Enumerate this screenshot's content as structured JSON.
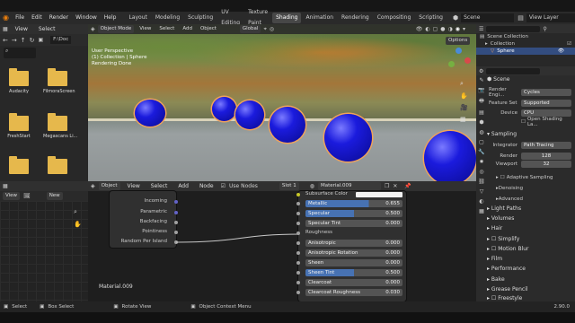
{
  "topbar": {
    "menus": [
      "File",
      "Edit",
      "Render",
      "Window",
      "Help"
    ],
    "workspaces": [
      "Layout",
      "Modeling",
      "Sculpting",
      "UV Editing",
      "Texture Paint",
      "Shading",
      "Animation",
      "Rendering",
      "Compositing",
      "Scripting"
    ],
    "active_workspace": "Shading",
    "scene": "Scene",
    "view_layer": "View Layer"
  },
  "filebrowser": {
    "menus": [
      "View",
      "Select"
    ],
    "path": "F:\\Doc",
    "folders": [
      "Audacity",
      "FilmoraScreen",
      "FreshStart",
      "Megascans Li..."
    ]
  },
  "viewport": {
    "mode": "Object Mode",
    "menus": [
      "View",
      "Select",
      "Add",
      "Object"
    ],
    "orientation": "Global",
    "options": "Options",
    "info1": "User Perspective",
    "info2": "(1) Collection | Sphere",
    "info3": "Rendering Done"
  },
  "outliner": {
    "root": "Scene Collection",
    "collection": "Collection",
    "object": "Sphere"
  },
  "properties": {
    "header": "Scene",
    "render_engine_label": "Render Engi...",
    "render_engine": "Cycles",
    "feature_set_label": "Feature Set",
    "feature_set": "Supported",
    "device_label": "Device",
    "device": "CPU",
    "osl": "Open Shading La...",
    "sampling": "Sampling",
    "integrator_label": "Integrator",
    "integrator": "Path Tracing",
    "render_label": "Render",
    "render_samples": "128",
    "viewport_label": "Viewport",
    "viewport_samples": "32",
    "adaptive": "Adaptive Sampling",
    "denoising": "Denoising",
    "advanced": "Advanced",
    "sections": [
      "Light Paths",
      "Volumes",
      "Hair",
      "Simplify",
      "Motion Blur",
      "Film",
      "Performance",
      "Bake",
      "Grease Pencil",
      "Freestyle"
    ]
  },
  "smallview": {
    "view": "View",
    "new": "New"
  },
  "nodeeditor": {
    "menus": [
      "Object",
      "View",
      "Select",
      "Add",
      "Node"
    ],
    "use_nodes": "Use Nodes",
    "slot": "Slot 1",
    "material": "Material.009",
    "footer_material": "Material.009",
    "node_outputs": [
      "Incoming",
      "Parametric",
      "Backfacing",
      "Pointiness",
      "Random Per Island"
    ],
    "bsdf": {
      "subsurface_color": "Subsurface Color",
      "rows": [
        {
          "label": "Metallic",
          "value": "0.655",
          "fill": 0.655
        },
        {
          "label": "Specular",
          "value": "0.500",
          "fill": 0.5
        },
        {
          "label": "Specular Tint",
          "value": "0.000",
          "fill": 0
        },
        {
          "label": "Roughness",
          "value": "",
          "fill": 0
        },
        {
          "label": "Anisotropic",
          "value": "0.000",
          "fill": 0
        },
        {
          "label": "Anisotropic Rotation",
          "value": "0.000",
          "fill": 0
        },
        {
          "label": "Sheen",
          "value": "0.000",
          "fill": 0
        },
        {
          "label": "Sheen Tint",
          "value": "0.500",
          "fill": 0.5
        },
        {
          "label": "Clearcoat",
          "value": "0.000",
          "fill": 0
        },
        {
          "label": "Clearcoat Roughness",
          "value": "0.030",
          "fill": 0.03
        }
      ]
    }
  },
  "statusbar": {
    "select": "Select",
    "box_select": "Box Select",
    "rotate_view": "Rotate View",
    "context_menu": "Object Context Menu",
    "version": "2.90.0"
  }
}
